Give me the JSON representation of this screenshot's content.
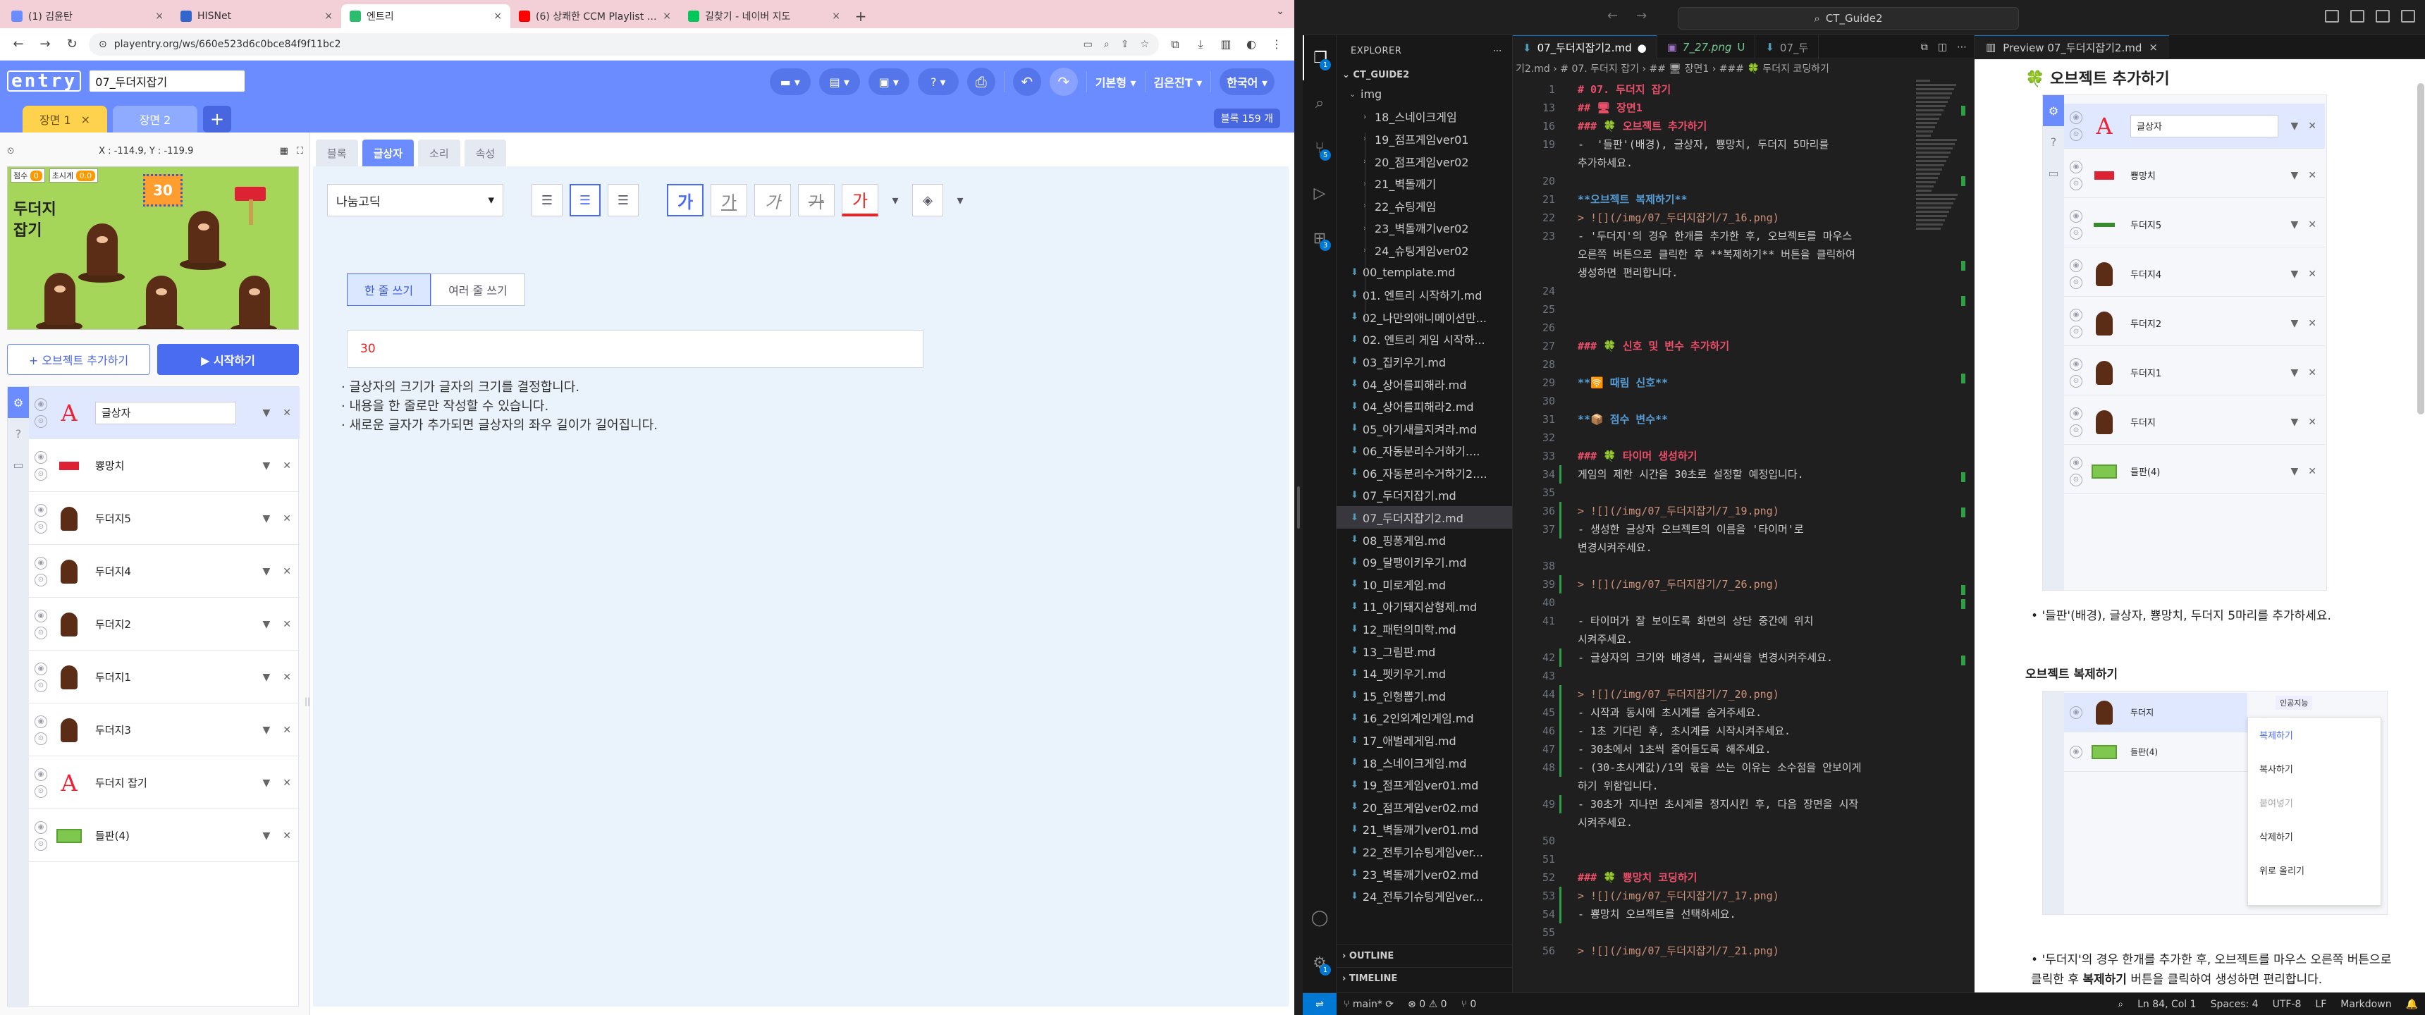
{
  "chrome": {
    "tabs": [
      {
        "title": "(1) 김윤탄",
        "fav": "#6b8cff",
        "active": false
      },
      {
        "title": "HISNet",
        "fav": "#3366cc",
        "active": false
      },
      {
        "title": "엔트리",
        "fav": "#2bbd6e",
        "active": true
      },
      {
        "title": "(6) 상쾌한 CCM Playlist | ...",
        "fav": "#ff0000",
        "active": false
      },
      {
        "title": "길찾기 - 네이버 지도",
        "fav": "#03c75a",
        "active": false
      }
    ],
    "url": "playentry.org/ws/660e523d6c0bce84f9f11bc2"
  },
  "entry": {
    "logo": "entry",
    "project_name": "07_두더지잡기",
    "header_right": {
      "mode": "기본형 ▾",
      "user": "김은진T ▾",
      "lang": "한국어 ▾"
    },
    "scenes": [
      {
        "label": "장면 1",
        "close": "×"
      },
      {
        "label": "장면 2"
      }
    ],
    "block_count": "블록 159 개",
    "coords": "X : -114.9,  Y : -119.9",
    "stage": {
      "title": "두더지 잡기",
      "score_label": "점수",
      "score_value": "0",
      "timer_label": "초시계",
      "timer_value": "0.0",
      "big_timer": "30"
    },
    "add_object": "+ 오브젝트 추가하기",
    "start": "▶ 시작하기",
    "objects": [
      {
        "name": "글상자",
        "thumb": "text"
      },
      {
        "name": "뿅망치",
        "thumb": "hammer"
      },
      {
        "name": "두더지5",
        "thumb": "mole"
      },
      {
        "name": "두더지4",
        "thumb": "mole"
      },
      {
        "name": "두더지2",
        "thumb": "mole"
      },
      {
        "name": "두더지1",
        "thumb": "mole"
      },
      {
        "name": "두더지3",
        "thumb": "mole"
      },
      {
        "name": "두더지 잡기",
        "thumb": "text"
      },
      {
        "name": "들판(4)",
        "thumb": "field"
      }
    ],
    "workspace_tabs": [
      "블록",
      "글상자",
      "소리",
      "속성"
    ],
    "active_workspace_tab": 1,
    "font": "나눔고딕",
    "write_modes": [
      "한 줄 쓰기",
      "여러 줄 쓰기"
    ],
    "text_value": "30",
    "notes": [
      "· 글상자의 크기가 글자의 크기를 결정합니다.",
      "· 내용을 한 줄로만 작성할 수 있습니다.",
      "· 새로운 글자가 추가되면 글상자의 좌우 길이가 길어집니다."
    ]
  },
  "vscode": {
    "search": "CT_Guide2",
    "explorer_title": "EXPLORER",
    "root": "CT_GUIDE2",
    "folder_img": "img",
    "img_children": [
      "18_스네이크게임",
      "19_점프게임ver01",
      "20_점프게임ver02",
      "21_벽돌깨기",
      "22_슈팅게임",
      "23_벽돌깨기ver02",
      "24_슈팅게임ver02"
    ],
    "files": [
      "00_template.md",
      "01. 엔트리 시작하기.md",
      "02_나만의애니메이션만...",
      "02. 엔트리 게임 시작하...",
      "03_집키우기.md",
      "04_상어를피해라.md",
      "04_상어를피해라2.md",
      "05_아기새를지켜라.md",
      "06_자동분리수거하기....",
      "06_자동분리수거하기2....",
      "07_두더지잡기.md",
      "07_두더지잡기2.md",
      "08_핑퐁게임.md",
      "09_달팽이키우기.md",
      "10_미로게임.md",
      "11_아기돼지삼형제.md",
      "12_패턴의미학.md",
      "13_그림판.md",
      "14_펫키우기.md",
      "15_인형뽑기.md",
      "16_2인외계인게임.md",
      "17_애벌레게임.md",
      "18_스네이크게임.md",
      "19_점프게임ver01.md",
      "20_점프게임ver02.md",
      "21_벽돌깨기ver01.md",
      "22_전투기슈팅게임ver...",
      "23_벽돌깨기ver02.md",
      "24_전투기슈팅게임ver..."
    ],
    "selected_file": "07_두더지잡기2.md",
    "outline": "OUTLINE",
    "timeline": "TIMELINE",
    "editor_tabs": [
      {
        "label": "07_두더지잡기2.md",
        "dot": "●",
        "on": true
      },
      {
        "label": "7_27.png",
        "flag": "U",
        "on": false
      },
      {
        "label": "07_두",
        "on": false
      }
    ],
    "breadcrumb": "기2.md  ›  # 07. 두더지 잡기  ›  ## 🖥 장면1  ›  ### 🍀 두더지 코딩하기",
    "lines": [
      {
        "n": "1",
        "t": "# 07. 두더지 잡기",
        "c": "h"
      },
      {
        "n": "13",
        "t": "## 🖥 장면1",
        "c": "h"
      },
      {
        "n": "16",
        "t": "### 🍀 오브젝트 추가하기",
        "c": "h"
      },
      {
        "n": "19",
        "t": "-  '들판'(배경), 글상자, 뿅망치, 두더지 5마리를",
        "c": ""
      },
      {
        "n": "",
        "t": "추가하세요.",
        "c": ""
      },
      {
        "n": "20",
        "t": "",
        "c": ""
      },
      {
        "n": "21",
        "t": "**오브젝트 복제하기**",
        "c": "b"
      },
      {
        "n": "22",
        "t": "> ![](/img/07_두더지잡기/7_16.png)",
        "c": "lk"
      },
      {
        "n": "23",
        "t": "- '두더지'의 경우 한개를 추가한 후, 오브젝트를 마우스",
        "c": ""
      },
      {
        "n": "",
        "t": "오른쪽 버튼으로 클릭한 후 **복제하기** 버튼을 클릭하여",
        "c": ""
      },
      {
        "n": "",
        "t": "생성하면 편리합니다.",
        "c": ""
      },
      {
        "n": "24",
        "t": "",
        "c": ""
      },
      {
        "n": "25",
        "t": "",
        "c": ""
      },
      {
        "n": "26",
        "t": "",
        "c": ""
      },
      {
        "n": "27",
        "t": "### 🍀 신호 및 변수 추가하기",
        "c": "h"
      },
      {
        "n": "28",
        "t": "",
        "c": ""
      },
      {
        "n": "29",
        "t": "**🛜 때림 신호**",
        "c": "b"
      },
      {
        "n": "30",
        "t": "",
        "c": ""
      },
      {
        "n": "31",
        "t": "**📦 점수 변수**",
        "c": "b"
      },
      {
        "n": "32",
        "t": "",
        "c": ""
      },
      {
        "n": "33",
        "t": "### 🍀 타이머 생성하기",
        "c": "h"
      },
      {
        "n": "34",
        "t": "게임의 제한 시간을 30초로 설정할 예정입니다.",
        "c": ""
      },
      {
        "n": "35",
        "t": "",
        "c": ""
      },
      {
        "n": "36",
        "t": "> ![](/img/07_두더지잡기/7_19.png)",
        "c": "lk"
      },
      {
        "n": "37",
        "t": "- 생성한 글상자 오브젝트의 이름을 '타이머'로",
        "c": ""
      },
      {
        "n": "",
        "t": "변경시켜주세요.",
        "c": ""
      },
      {
        "n": "38",
        "t": "",
        "c": ""
      },
      {
        "n": "39",
        "t": "> ![](/img/07_두더지잡기/7_26.png)",
        "c": "lk"
      },
      {
        "n": "40",
        "t": "",
        "c": ""
      },
      {
        "n": "41",
        "t": "- 타이머가 잘 보이도록 화면의 상단 중간에 위치",
        "c": ""
      },
      {
        "n": "",
        "t": "시켜주세요.",
        "c": ""
      },
      {
        "n": "42",
        "t": "- 글상자의 크기와 배경색, 글씨색을 변경시켜주세요.",
        "c": ""
      },
      {
        "n": "43",
        "t": "",
        "c": ""
      },
      {
        "n": "44",
        "t": "> ![](/img/07_두더지잡기/7_20.png)",
        "c": "lk"
      },
      {
        "n": "45",
        "t": "- 시작과 동시에 초시계를 숨겨주세요.",
        "c": ""
      },
      {
        "n": "46",
        "t": "- 1초 기다린 후, 초시계를 시작시켜주세요.",
        "c": ""
      },
      {
        "n": "47",
        "t": "- 30초에서 1초씩 줄어들도록 해주세요.",
        "c": ""
      },
      {
        "n": "48",
        "t": "- (30-초시계값)/1의 몫을 쓰는 이유는 소수점을 안보이게",
        "c": ""
      },
      {
        "n": "",
        "t": "하기 위함입니다.",
        "c": ""
      },
      {
        "n": "49",
        "t": "- 30초가 지나면 초시계를 정지시킨 후, 다음 장면을 시작",
        "c": ""
      },
      {
        "n": "",
        "t": "시켜주세요.",
        "c": ""
      },
      {
        "n": "50",
        "t": "",
        "c": ""
      },
      {
        "n": "51",
        "t": "",
        "c": ""
      },
      {
        "n": "52",
        "t": "### 🍀 뿅망치 코딩하기",
        "c": "h"
      },
      {
        "n": "53",
        "t": "> ![](/img/07_두더지잡기/7_17.png)",
        "c": "lk"
      },
      {
        "n": "54",
        "t": "- 뿅망치 오브젝트를 선택하세요.",
        "c": ""
      },
      {
        "n": "55",
        "t": "",
        "c": ""
      },
      {
        "n": "56",
        "t": "> ![](/img/07_두더지잡기/7_21.png)",
        "c": "lk"
      }
    ],
    "preview_tab": "Preview 07_두더지잡기2.md",
    "preview": {
      "h3": "🍀 오브젝트 추가하기",
      "objects": [
        "글상자",
        "뿅망치",
        "두더지5",
        "두더지4",
        "두더지2",
        "두더지1",
        "두더지",
        "들판(4)"
      ],
      "bullet1": "'들판'(배경), 글상자, 뿅망치, 두더지 5마리를 추가하세요.",
      "copy_head": "오브젝트 복제하기",
      "copy_badge": "인공지능",
      "copy_rows": [
        "두더지",
        "들판(4)"
      ],
      "ctx": [
        "복제하기",
        "복사하기",
        "붙여넣기",
        "삭제하기",
        "위로 올리기"
      ],
      "bullet2_a": "'두더지'의 경우 한개를 추가한 후, 오브젝트를 마우스 오른쪽 버튼으로 클릭한 후 ",
      "bullet2_b": "복제하기",
      "bullet2_c": " 버튼을 클릭하여 생성하면 편리합니다."
    },
    "status": {
      "branch": "main*",
      "sync": "⟳",
      "problems": "⊗ 0  ⚠ 0",
      "ports": "⑂ 0",
      "pos": "Ln 84, Col 1",
      "spaces": "Spaces: 4",
      "enc": "UTF-8",
      "eol": "LF",
      "lang": "Markdown"
    }
  }
}
